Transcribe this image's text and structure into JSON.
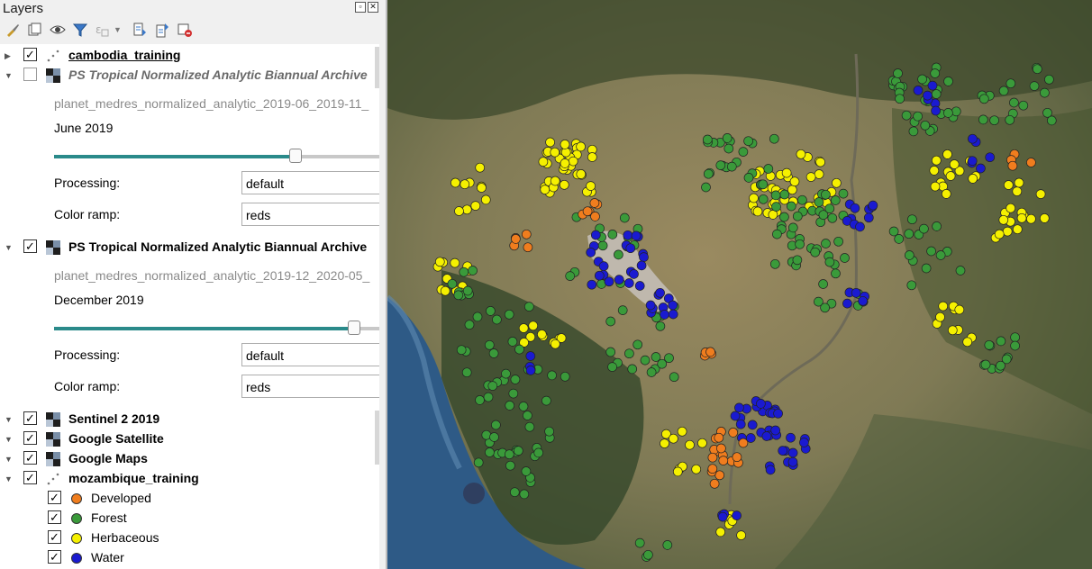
{
  "panel": {
    "title": "Layers"
  },
  "toolbar": {
    "icons": [
      "style-brush-icon",
      "add-group-icon",
      "visibility-eye-icon",
      "filter-icon",
      "expression-filter-icon",
      "dropdown-arrow-icon",
      "expand-all-icon",
      "collapse-all-icon",
      "remove-layer-icon"
    ]
  },
  "layers": {
    "cambodia": {
      "name": "cambodia_training",
      "checked": true
    },
    "ps_june": {
      "name": "PS Tropical Normalized Analytic Biannual Archive",
      "checked": false,
      "source": "planet_medres_normalized_analytic_2019-06_2019-11_",
      "period": "June 2019",
      "slider_fraction": 0.74,
      "processing_label": "Processing:",
      "processing": "default",
      "ramp_label": "Color ramp:",
      "ramp": "reds"
    },
    "ps_dec": {
      "name": "PS Tropical Normalized Analytic Biannual Archive",
      "checked": true,
      "source": "planet_medres_normalized_analytic_2019-12_2020-05_",
      "period": "December 2019",
      "slider_fraction": 0.92,
      "processing_label": "Processing:",
      "processing": "default",
      "ramp_label": "Color ramp:",
      "ramp": "reds"
    },
    "sentinel": {
      "name": "Sentinel 2 2019",
      "checked": true
    },
    "google_sat": {
      "name": "Google Satellite",
      "checked": true
    },
    "google_maps": {
      "name": "Google Maps",
      "checked": true
    },
    "mozambique": {
      "name": "mozambique_training",
      "checked": true
    }
  },
  "legend": [
    {
      "label": "Developed",
      "color": "#f07d1e"
    },
    {
      "label": "Forest",
      "color": "#3a9a3a"
    },
    {
      "label": "Herbaceous",
      "color": "#f5f000"
    },
    {
      "label": "Water",
      "color": "#1a1ad0"
    }
  ],
  "colors": {
    "slider": "#2a8a8a",
    "accent_dark": "#1e1e1e"
  }
}
